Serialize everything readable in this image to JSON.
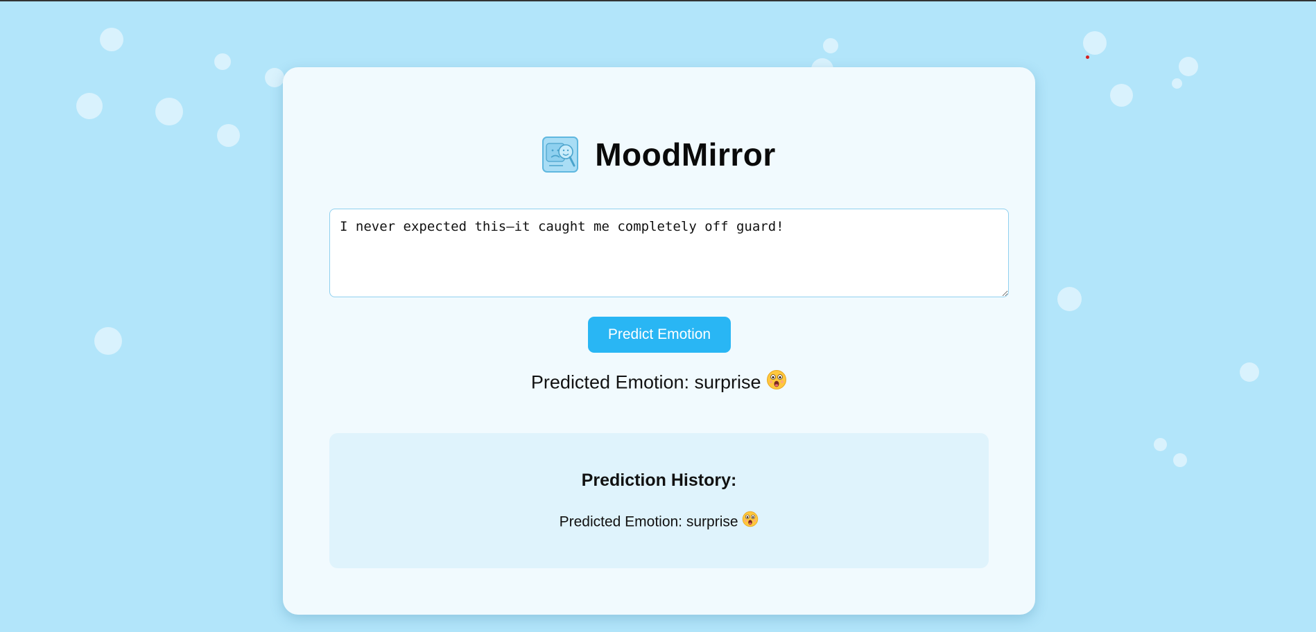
{
  "app": {
    "title": "MoodMirror",
    "logo_icon": "mood-mirror-logo-icon"
  },
  "input": {
    "value": "I never expected this—it caught me completely off guard!"
  },
  "button": {
    "predict_label": "Predict Emotion"
  },
  "result": {
    "label": "Predicted Emotion: surprise",
    "emotion": "surprise",
    "emoji_icon": "astonished-face-icon"
  },
  "history": {
    "title": "Prediction History:",
    "items": [
      {
        "label": "Predicted Emotion: surprise",
        "emoji_icon": "astonished-face-icon"
      }
    ]
  },
  "colors": {
    "background": "#b2e5fa",
    "card": "#f1fafe",
    "accent": "#29b6f4",
    "history_panel": "#dff3fc"
  }
}
